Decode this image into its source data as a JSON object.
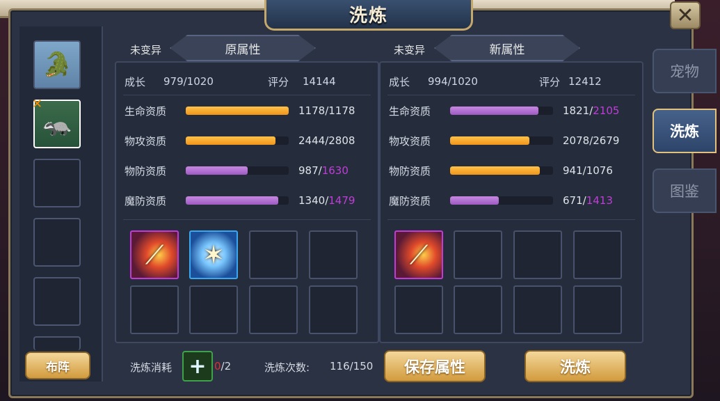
{
  "title": "洗炼",
  "close_icon": "close-icon",
  "left_button": "布阵",
  "side_tabs": [
    {
      "label": "宠物",
      "active": false
    },
    {
      "label": "洗炼",
      "active": true
    },
    {
      "label": "图鉴",
      "active": false
    }
  ],
  "left_panel": {
    "mutation": "未变异",
    "header": "原属性",
    "growth_label": "成长",
    "growth": "979/1020",
    "score_label": "评分",
    "score": "14144",
    "stats": [
      {
        "label": "生命资质",
        "cur": "1178",
        "max": "1178",
        "max_purple": false,
        "pct": 1.0,
        "color": "gold"
      },
      {
        "label": "物攻资质",
        "cur": "2444",
        "max": "2808",
        "max_purple": false,
        "pct": 0.87,
        "color": "gold"
      },
      {
        "label": "物防资质",
        "cur": "987",
        "max": "1630",
        "max_purple": true,
        "pct": 0.6,
        "color": "purple"
      },
      {
        "label": "魔防资质",
        "cur": "1340",
        "max": "1479",
        "max_purple": true,
        "pct": 0.9,
        "color": "purple"
      }
    ]
  },
  "right_panel": {
    "mutation": "未变异",
    "header": "新属性",
    "growth_label": "成长",
    "growth": "994/1020",
    "score_label": "评分",
    "score": "12412",
    "stats": [
      {
        "label": "生命资质",
        "cur": "1821",
        "max": "2105",
        "max_purple": true,
        "pct": 0.86,
        "color": "purple"
      },
      {
        "label": "物攻资质",
        "cur": "2078",
        "max": "2679",
        "max_purple": false,
        "pct": 0.77,
        "color": "gold"
      },
      {
        "label": "物防资质",
        "cur": "941",
        "max": "1076",
        "max_purple": false,
        "pct": 0.87,
        "color": "gold"
      },
      {
        "label": "魔防资质",
        "cur": "671",
        "max": "1413",
        "max_purple": true,
        "pct": 0.47,
        "color": "purple"
      }
    ]
  },
  "footer": {
    "cost_label": "洗炼消耗",
    "cost_have": "0",
    "cost_need": "/2",
    "count_label": "洗炼次数:",
    "count_value": "116/150",
    "save_button": "保存属性",
    "refine_button": "洗炼"
  }
}
